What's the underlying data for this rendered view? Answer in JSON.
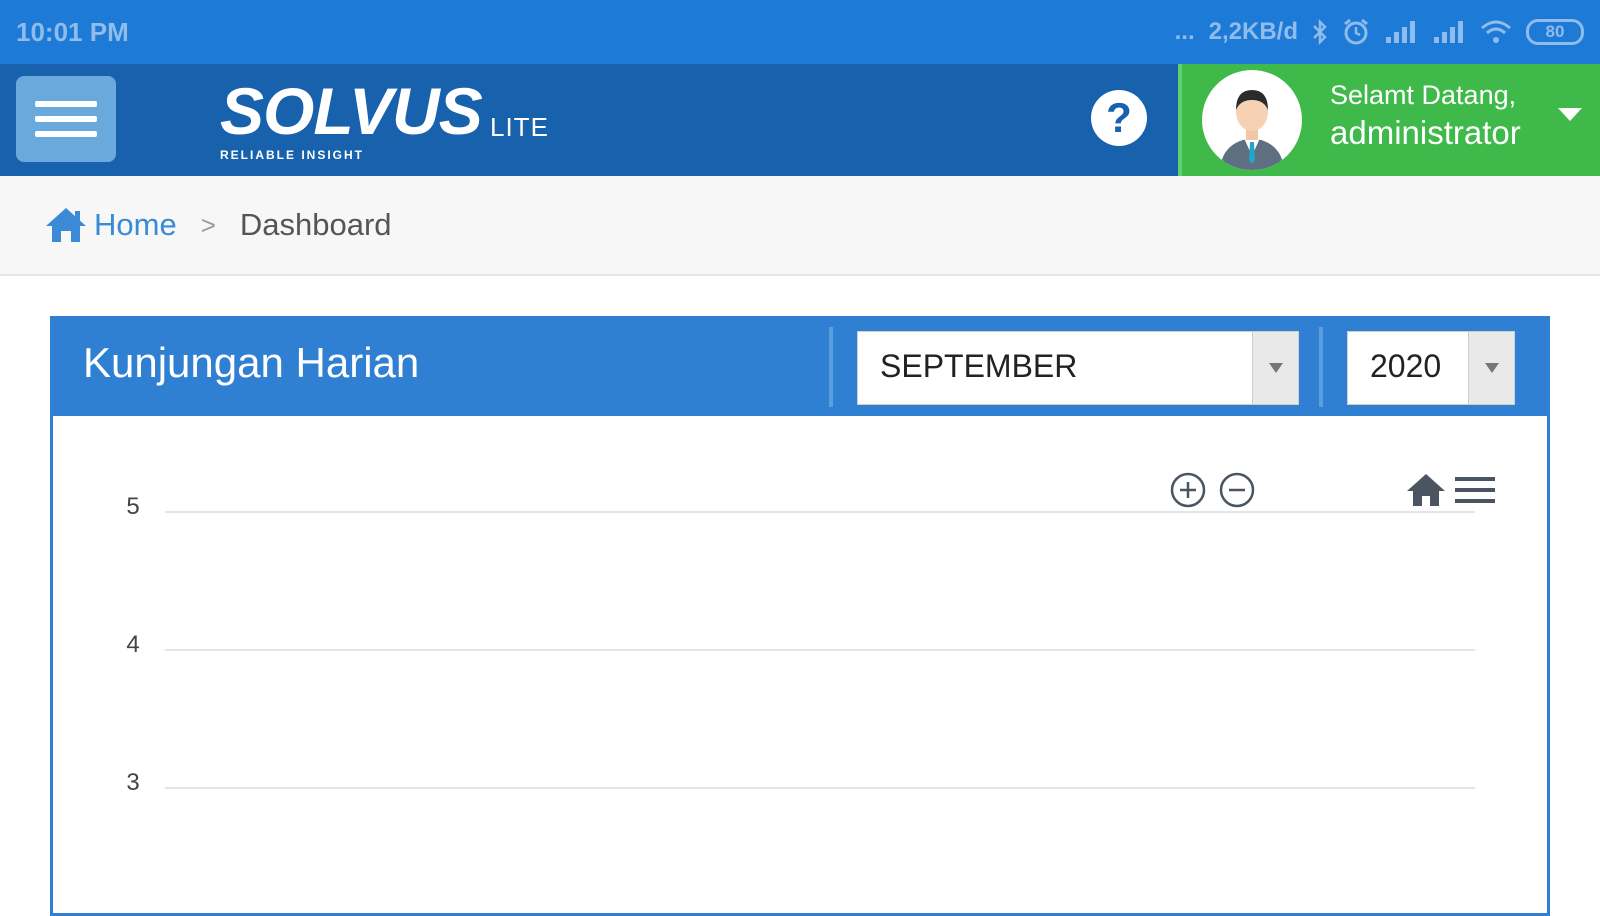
{
  "status_bar": {
    "time": "10:01 PM",
    "more": "...",
    "speed": "2,2KB/d",
    "battery": "80"
  },
  "header": {
    "brand": "SOLVUS",
    "brand_suffix": "LITE",
    "tagline": "RELIABLE INSIGHT",
    "help_label": "?",
    "greeting": "Selamt Datang,",
    "username": "administrator"
  },
  "breadcrumb": {
    "home": "Home",
    "separator": ">",
    "current": "Dashboard"
  },
  "panel": {
    "title": "Kunjungan Harian",
    "month_select": {
      "selected": "SEPTEMBER"
    },
    "year_select": {
      "selected": "2020"
    }
  },
  "chart_data": {
    "type": "line",
    "title": "",
    "xlabel": "",
    "ylabel": "",
    "y_ticks": [
      "5",
      "4",
      "3"
    ],
    "ylim_visible": [
      3,
      5
    ],
    "grid": true,
    "toolbar": [
      "zoom-in-icon",
      "zoom-out-icon",
      "reset-zoom-home-icon",
      "chart-menu-icon"
    ]
  },
  "colors": {
    "status_bar": "#1d7ad6",
    "header": "#1761ad",
    "user_panel": "#3fba4a",
    "panel_accent": "#2f7fd2",
    "breadcrumb_link": "#3a8ad6"
  }
}
